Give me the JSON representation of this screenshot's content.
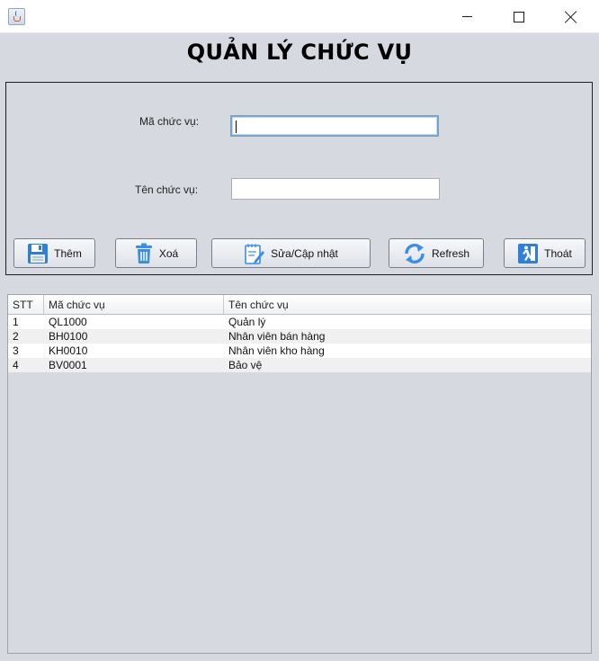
{
  "window": {
    "title_icon": "java-cup-icon",
    "controls": [
      "minimize-icon",
      "maximize-icon",
      "close-icon"
    ]
  },
  "page_title": "QUẢN LÝ CHỨC VỤ",
  "form": {
    "ma_label": "Mã chức vụ:",
    "ma_value": "",
    "ten_label": "Tên chức vụ:",
    "ten_value": ""
  },
  "buttons": {
    "them": {
      "label": "Thêm",
      "icon": "save-disk-icon"
    },
    "xoa": {
      "label": "Xoá",
      "icon": "trash-icon"
    },
    "sua": {
      "label": "Sửa/Cập nhật",
      "icon": "edit-notepad-icon"
    },
    "refresh": {
      "label": "Refresh",
      "icon": "refresh-arrows-icon"
    },
    "thoat": {
      "label": "Thoát",
      "icon": "exit-door-icon"
    }
  },
  "table": {
    "headers": [
      "STT",
      "Mã chức vụ",
      "Tên chức vụ"
    ],
    "rows": [
      [
        "1",
        "QL1000",
        "Quản lý"
      ],
      [
        "2",
        "BH0100",
        "Nhân viên bán hàng"
      ],
      [
        "3",
        "KH0010",
        "Nhân viên kho hàng"
      ],
      [
        "4",
        "BV0001",
        "Bảo vệ"
      ]
    ]
  },
  "colors": {
    "background": "#d6d9df",
    "accent_blue": "#2f7fd8"
  }
}
